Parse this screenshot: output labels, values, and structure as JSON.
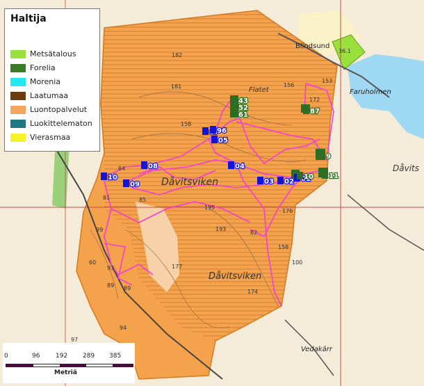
{
  "legend": {
    "title": "Haltija",
    "items": [
      {
        "label": "Metsätalous",
        "color": "#99e03c"
      },
      {
        "label": "Forelia",
        "color": "#3c7a28"
      },
      {
        "label": "Morenia",
        "color": "#22e8f0"
      },
      {
        "label": "Laatumaa",
        "color": "#6a3c10"
      },
      {
        "label": "Luontopalvelut",
        "color": "#f4a560"
      },
      {
        "label": "Luokittelematon",
        "color": "#1e7a80"
      },
      {
        "label": "Vierasmaa",
        "color": "#f6f22a"
      }
    ]
  },
  "scalebar": {
    "labels": [
      "0",
      "96",
      "192",
      "289",
      "385"
    ],
    "unit": "Metriä"
  },
  "places": {
    "blindsund": "Blindsund",
    "faruholmen": "Faruholmen",
    "davitsviken": "Dåvitsviken",
    "davitsviken2": "Dåvitsviken",
    "davits": "Dåvits",
    "vedakarr": "Vedakärr",
    "flatet": "Flatet"
  },
  "markers": {
    "m10a": "10",
    "m09": "09",
    "m08": "08",
    "m07": "07",
    "m96": "96",
    "m05": "05",
    "m04": "04",
    "m03": "03",
    "m02": "02",
    "m01": "01",
    "m10b": "10",
    "m11": "11",
    "m43": "43",
    "m52": "52",
    "m61": "61",
    "m87": "87",
    "m9": "9"
  },
  "contours": {
    "c182": "182",
    "c181": "181",
    "c156": "156",
    "c158": "158",
    "c153": "153",
    "c172": "172",
    "c85": "85",
    "c81": "81",
    "c84": "84",
    "c99": "99",
    "c195": "195",
    "c176": "176",
    "c158b": "158",
    "c177": "177",
    "c193": "193",
    "c89": "89",
    "c93": "93",
    "c60": "60",
    "c94": "94",
    "c97": "97",
    "c174": "174",
    "c100": "100",
    "c89b": "89",
    "c82": "82",
    "c361": "36.1"
  },
  "colors": {
    "area": "#f4a24c",
    "water": "#9fd8f2",
    "track": "#f43cd8",
    "marker": "#1414d8",
    "forelia": "#2e6e24",
    "metsatalous": "#99e03c"
  }
}
